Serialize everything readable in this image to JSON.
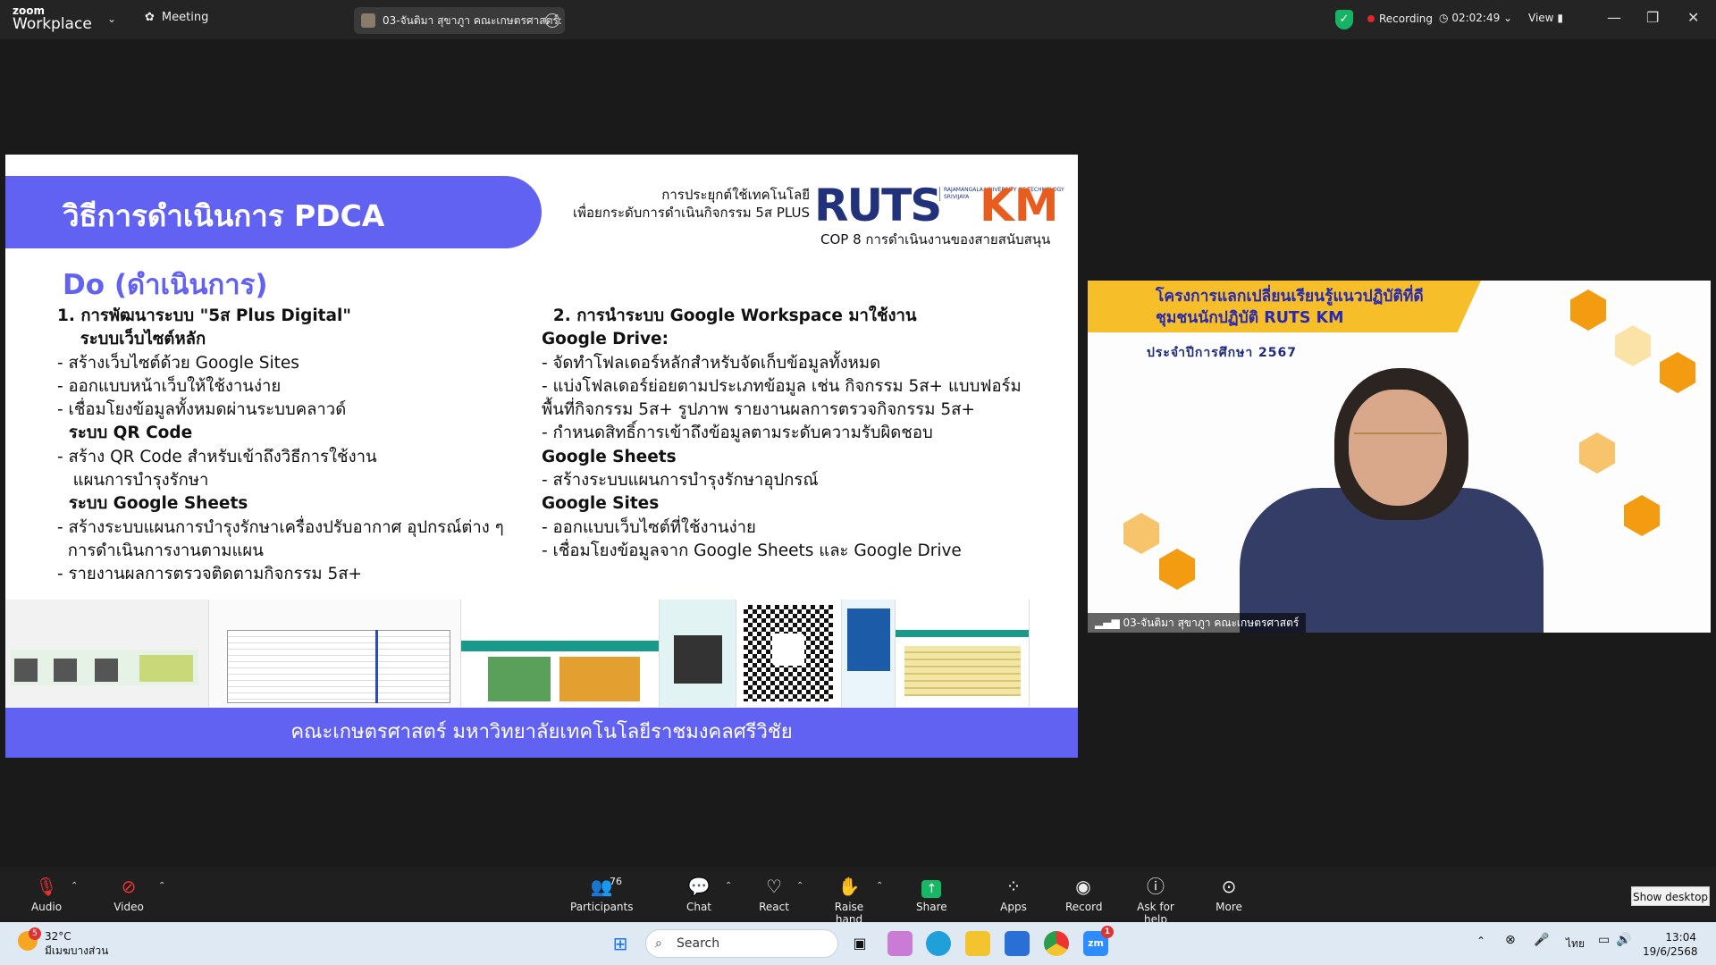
{
  "titlebar": {
    "app_line1": "zoom",
    "app_line2": "Workplace",
    "meeting_label": "Meeting",
    "participant_pill": "03-จันติมา สุขาภูา คณะเกษตรศาสตร์:",
    "recording_label": "Recording",
    "timer": "02:02:49",
    "view_label": "View"
  },
  "slide": {
    "banner_title": "วิธีการดำเนินการ  PDCA",
    "org_line1": "การประยุกต์ใช้เทคโนโลยี",
    "org_line2": "เพื่อยกระดับการดำเนินกิจกรรม 5ส PLUS",
    "ruts_logo": "RUTS",
    "univ_text": "RAJAMANGALA UNIVERSITY OF TECHNOLOGY SRIVIJAYA",
    "km_logo": "KM",
    "cop_line": "COP 8 การดำเนินงานของสายสนับสนุน",
    "section_title": "Do (ดำเนินการ)",
    "left_lines": [
      {
        "text": "1. การพัฒนาระบบ \"5ส Plus Digital\"",
        "bold": true
      },
      {
        "text": "    ระบบเว็บไซต์หลัก",
        "bold": true
      },
      {
        "text": "- สร้างเว็บไซต์ด้วย Google Sites",
        "bold": false
      },
      {
        "text": "- ออกแบบหน้าเว็บให้ใช้งานง่าย",
        "bold": false
      },
      {
        "text": "- เชื่อมโยงข้อมูลทั้งหมดผ่านระบบคลาวด์",
        "bold": false
      },
      {
        "text": "  ระบบ QR Code",
        "bold": true
      },
      {
        "text": "- สร้าง QR Code สำหรับเข้าถึงวิธีการใช้งาน",
        "bold": false
      },
      {
        "text": "   แผนการบำรุงรักษา",
        "bold": false
      },
      {
        "text": "  ระบบ Google Sheets",
        "bold": true
      },
      {
        "text": "- สร้างระบบแผนการบำรุงรักษาเครื่องปรับอากาศ อุปกรณ์ต่าง ๆ",
        "bold": false
      },
      {
        "text": "  การดำเนินการงานตามแผน",
        "bold": false
      },
      {
        "text": "- รายงานผลการตรวจติดตามกิจกรรม 5ส+",
        "bold": false
      }
    ],
    "right_lines": [
      {
        "text": "  2. การนำระบบ Google Workspace มาใช้งาน",
        "bold": true
      },
      {
        "text": "Google Drive:",
        "bold": true
      },
      {
        "text": "- จัดทำโฟลเดอร์หลักสำหรับจัดเก็บข้อมูลทั้งหมด",
        "bold": false
      },
      {
        "text": "- แบ่งโฟลเดอร์ย่อยตามประเภทข้อมูล เช่น กิจกรรม 5ส+ แบบฟอร์ม",
        "bold": false
      },
      {
        "text": "พื้นที่กิจกรรม 5ส+ รูปภาพ รายงานผลการตรวจกิจกรรม 5ส+",
        "bold": false
      },
      {
        "text": "- กำหนดสิทธิ์การเข้าถึงข้อมูลตามระดับความรับผิดชอบ",
        "bold": false
      },
      {
        "text": "Google Sheets",
        "bold": true
      },
      {
        "text": "- สร้างระบบแผนการบำรุงรักษาอุปกรณ์",
        "bold": false
      },
      {
        "text": "Google Sites",
        "bold": true
      },
      {
        "text": "- ออกแบบเว็บไซต์ที่ใช้งานง่าย",
        "bold": false
      },
      {
        "text": "- เชื่อมโยงข้อมูลจาก Google Sheets และ Google Drive",
        "bold": false
      }
    ],
    "footer": "คณะเกษตรศาสตร์ มหาวิทยาลัยเทคโนโลยีราชมงคลศรีวิชัย"
  },
  "video": {
    "banner_line1": "โครงการแลกเปลี่ยนเรียนรู้แนวปฏิบัติที่ดี",
    "banner_line2": "ชุมชนนักปฏิบัติ RUTS KM",
    "year_line": "ประจำปีการศึกษา 2567",
    "name_label": "03-จันติมา สุขาภูา คณะเกษตรศาสตร์"
  },
  "toolbar": {
    "audio": "Audio",
    "video": "Video",
    "participants": "Participants",
    "participants_count": "76",
    "chat": "Chat",
    "react": "React",
    "raise_hand": "Raise hand",
    "share": "Share",
    "apps": "Apps",
    "record": "Record",
    "ask_for_help": "Ask for help",
    "more": "More",
    "tooltip": "Show desktop"
  },
  "taskbar": {
    "weather_temp": "32°C",
    "weather_desc": "มีเมฆบางส่วน",
    "weather_badge": "5",
    "search_label": "Search",
    "lang": "ไทย",
    "time": "13:04",
    "date": "19/6/2568",
    "zoom_badge": "1"
  }
}
